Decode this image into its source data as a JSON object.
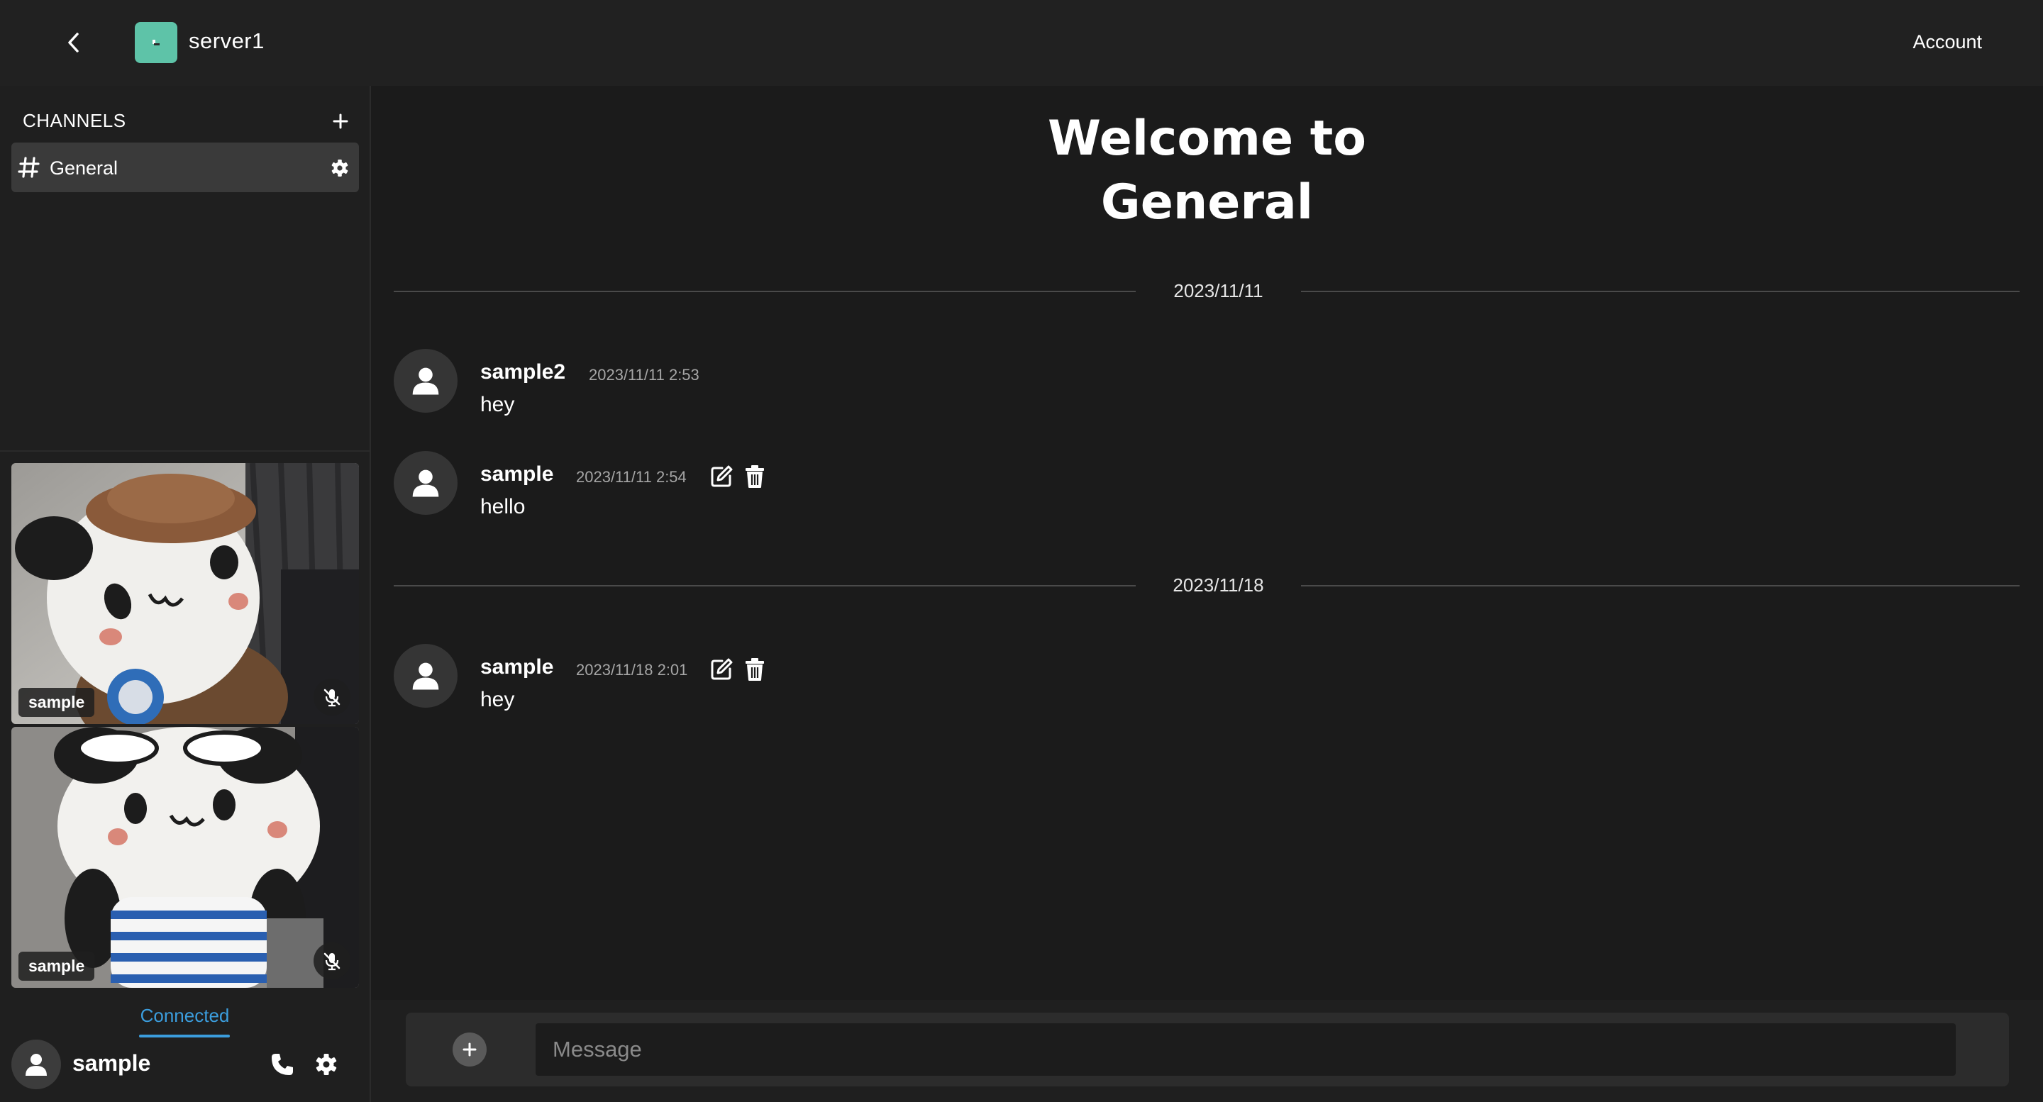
{
  "header": {
    "server_name": "server1",
    "account_label": "Account"
  },
  "sidebar": {
    "channels_heading": "CHANNELS",
    "channels": [
      {
        "label": "General",
        "selected": true
      }
    ],
    "video_tiles": [
      {
        "name": "sample",
        "muted": true
      },
      {
        "name": "sample",
        "muted": true
      }
    ],
    "voice_status": "Connected",
    "current_user": "sample"
  },
  "main": {
    "welcome_line1": "Welcome to",
    "welcome_line2": "General",
    "date_groups": [
      {
        "date": "2023/11/11",
        "messages": [
          {
            "author": "sample2",
            "time": "2023/11/11 2:53",
            "text": "hey",
            "own": false
          },
          {
            "author": "sample",
            "time": "2023/11/11 2:54",
            "text": "hello",
            "own": true
          }
        ]
      },
      {
        "date": "2023/11/18",
        "messages": [
          {
            "author": "sample",
            "time": "2023/11/18 2:01",
            "text": "hey",
            "own": true
          }
        ]
      }
    ]
  },
  "composer": {
    "placeholder": "Message"
  },
  "colors": {
    "accent": "#3b9ddd",
    "server_logo": "#5ec3a8",
    "background": "#1b1b1b",
    "header": "#212121",
    "selected_channel": "#3a3a3a"
  },
  "icons": {
    "back": "chevron-left-icon",
    "add_channel": "plus-icon",
    "channel": "hash-icon",
    "channel_settings": "gear-icon",
    "mute": "mic-off-icon",
    "avatar": "person-icon",
    "call": "phone-icon",
    "user_settings": "gear-icon",
    "edit": "edit-icon",
    "delete": "trash-icon",
    "attach": "plus-icon"
  }
}
